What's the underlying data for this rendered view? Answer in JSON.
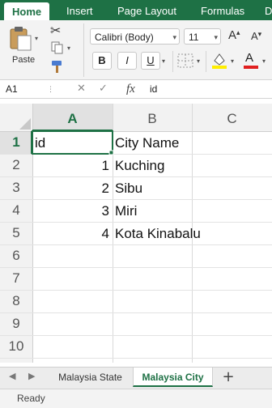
{
  "ribbon_tabs": [
    {
      "label": "Home",
      "active": true
    },
    {
      "label": "Insert",
      "active": false
    },
    {
      "label": "Page Layout",
      "active": false
    },
    {
      "label": "Formulas",
      "active": false
    },
    {
      "label": "D",
      "active": false
    }
  ],
  "clipboard": {
    "paste_label": "Paste"
  },
  "font": {
    "family": "Calibri (Body)",
    "size": "11",
    "grow": "A",
    "shrink": "A"
  },
  "format": {
    "bold": "B",
    "italic": "I",
    "underline": "U",
    "font_color_letter": "A"
  },
  "colors": {
    "accent": "#1e7145",
    "highlight": "#ffee00",
    "font_color": "#e01f1f"
  },
  "formula_bar": {
    "name_box": "A1",
    "fx": "fx",
    "value": "id"
  },
  "grid": {
    "columns": [
      "A",
      "B",
      "C"
    ],
    "selected_column": "A",
    "rows": [
      "1",
      "2",
      "3",
      "4",
      "5",
      "6",
      "7",
      "8",
      "9",
      "10"
    ],
    "selected_row": "1",
    "cells": {
      "A1": "id",
      "B1": "City Name",
      "A2": "1",
      "B2": "Kuching",
      "A3": "2",
      "B3": "Sibu",
      "A4": "3",
      "B4": "Miri",
      "A5": "4",
      "B5": "Kota Kinabalu"
    }
  },
  "sheets": [
    {
      "label": "Malaysia State",
      "active": false
    },
    {
      "label": "Malaysia City",
      "active": true
    }
  ],
  "add_sheet": "+",
  "status": "Ready"
}
